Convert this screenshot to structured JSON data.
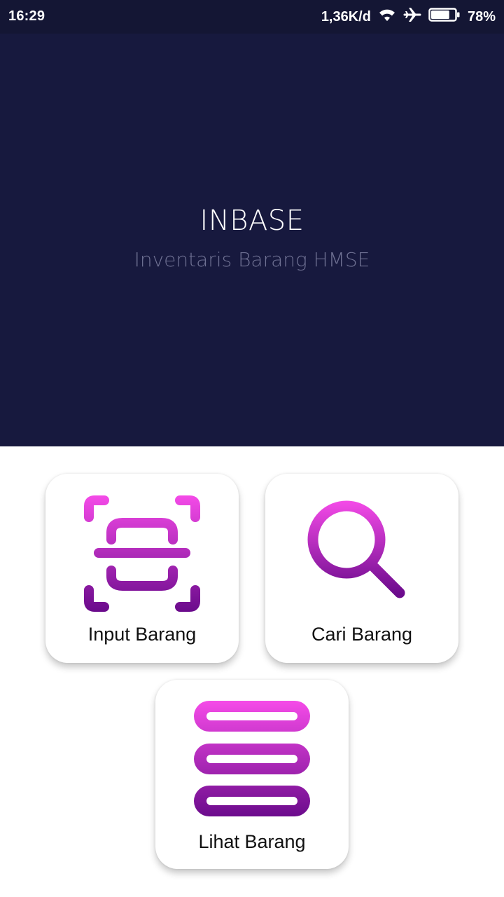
{
  "status_bar": {
    "time": "16:29",
    "net_speed": "1,36K/d",
    "battery_percent": "78%",
    "battery_level": 0.78,
    "icons": [
      "wifi-icon",
      "airplane-icon",
      "battery-icon"
    ]
  },
  "header": {
    "title": "INBASE",
    "subtitle": "Inventaris Barang HMSE"
  },
  "menu": {
    "input_label": "Input Barang",
    "search_label": "Cari Barang",
    "list_label": "Lihat Barang",
    "icons": [
      "scan-icon",
      "search-icon",
      "list-icon"
    ]
  },
  "colors": {
    "status_bar_bg": "#141634",
    "header_bg": "#17193e",
    "gradient_top": "#f54be8",
    "gradient_bottom": "#6b0b8c"
  }
}
